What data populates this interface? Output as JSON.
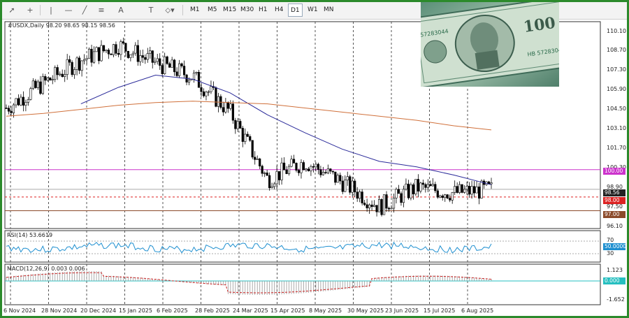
{
  "toolbar": {
    "icons": [
      "cursor-icon",
      "crosshair-icon",
      "vertical-line-icon",
      "horizontal-line-icon",
      "trendline-icon",
      "fibonacci-icon",
      "text-icon",
      "label-icon",
      "shapes-icon"
    ],
    "timeframes": [
      "M1",
      "M5",
      "M15",
      "M30",
      "H1",
      "H4",
      "D1",
      "W1",
      "MN"
    ],
    "active_timeframe": "D1"
  },
  "chart": {
    "header": "#USDX,Daily  98.20 98.65 98.15 98.56",
    "price_labels": [
      "110.10",
      "108.70",
      "107.30",
      "105.90",
      "104.50",
      "103.10",
      "101.70",
      "100.30",
      "98.90",
      "97.50",
      "96.10"
    ],
    "price_badges": [
      {
        "text": "100.00",
        "price": 100.0,
        "color": "#cc33cc"
      },
      {
        "text": "98.56",
        "price": 98.56,
        "color": "#222222"
      },
      {
        "text": "98.00",
        "price": 98.0,
        "color": "#dd2222"
      },
      {
        "text": "97.00",
        "price": 97.0,
        "color": "#8b4a2a"
      }
    ],
    "horizontal_levels": [
      {
        "price": 100.0,
        "color": "#cc33cc",
        "style": "solid"
      },
      {
        "price": 98.0,
        "color": "#dd2222",
        "style": "dashed"
      },
      {
        "price": 97.0,
        "color": "#8b4a2a",
        "style": "solid"
      },
      {
        "price": 98.56,
        "color": "#aaaaaa",
        "style": "solid"
      }
    ],
    "x_labels": [
      "6 Nov 2024",
      "28 Nov 2024",
      "20 Dec 2024",
      "15 Jan 2025",
      "6 Feb 2025",
      "28 Feb 2025",
      "24 Mar 2025",
      "15 Apr 2025",
      "8 May 2025",
      "30 May 2025",
      "23 Jun 2025",
      "15 Jul 2025",
      "6 Aug 2025"
    ]
  },
  "rsi": {
    "header": "RSI(14) 53.6619",
    "levels": [
      "70",
      "30"
    ],
    "badge": "50.0000"
  },
  "macd": {
    "header": "MACD(12,26,9) 0.003 0.006",
    "labels": [
      "1.123",
      "0.000",
      "-1.652"
    ]
  },
  "chart_data": {
    "type": "candlestick",
    "symbol": "#USDX",
    "timeframe": "Daily",
    "ohlc_last": {
      "open": 98.2,
      "high": 98.65,
      "low": 98.15,
      "close": 98.56
    },
    "ylim": [
      95.7,
      110.8
    ],
    "x": [
      "6 Nov 2024",
      "28 Nov 2024",
      "20 Dec 2024",
      "15 Jan 2025",
      "6 Feb 2025",
      "28 Feb 2025",
      "24 Mar 2025",
      "15 Apr 2025",
      "8 May 2025",
      "30 May 2025",
      "23 Jun 2025",
      "15 Jul 2025",
      "6 Aug 2025",
      "20 Aug 2025"
    ],
    "close": [
      104.5,
      106.3,
      108.0,
      109.1,
      107.8,
      106.8,
      104.2,
      99.3,
      100.6,
      99.1,
      97.3,
      98.7,
      98.3,
      98.56
    ],
    "ma_fast": [
      null,
      null,
      104.8,
      106.0,
      106.9,
      106.6,
      105.6,
      104.0,
      102.7,
      101.5,
      100.6,
      100.2,
      99.6,
      98.9
    ],
    "ma_slow": [
      103.9,
      104.1,
      104.4,
      104.7,
      104.9,
      105.0,
      104.9,
      104.8,
      104.5,
      104.2,
      103.9,
      103.6,
      103.2,
      102.9
    ],
    "levels": [
      100.0,
      98.0,
      97.0
    ]
  }
}
